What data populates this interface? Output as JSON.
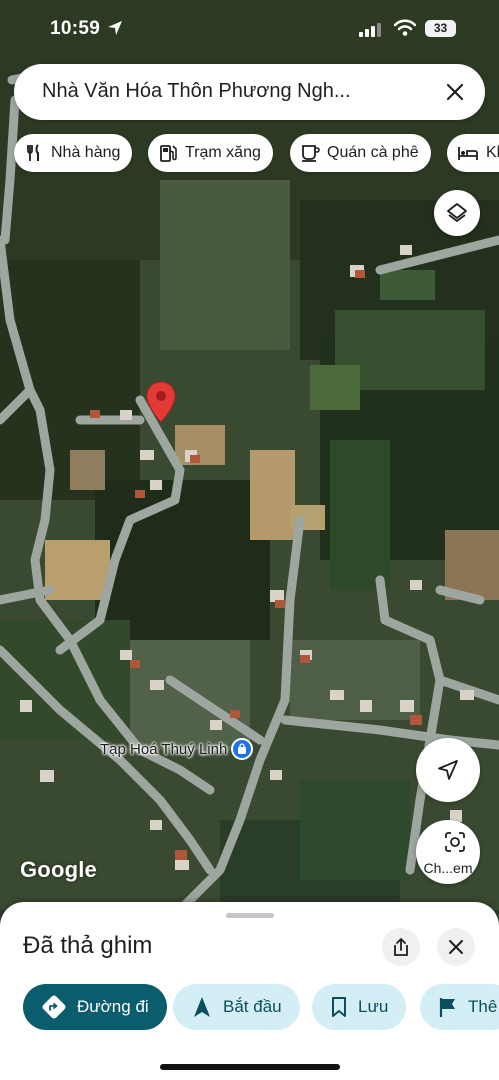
{
  "status_bar": {
    "time": "10:59",
    "battery": "33"
  },
  "search": {
    "query": "Nhà Văn Hóa Thôn Phương Ngh..."
  },
  "chips": [
    {
      "label": "Nhà hàng",
      "icon": "fork-knife-icon"
    },
    {
      "label": "Trạm xăng",
      "icon": "gas-station-icon"
    },
    {
      "label": "Quán cà phê",
      "icon": "coffee-cup-icon"
    },
    {
      "label": "Kh",
      "icon": "bed-icon"
    }
  ],
  "map": {
    "poi_label": "Tạp Hoá Thuý Linh",
    "attribution": "Google",
    "lens_label": "Ch...em",
    "colors": {
      "pin": "#e53935",
      "poi": "#1a73e8",
      "road": "#9ea6a0"
    }
  },
  "sheet": {
    "title": "Đã thả ghim",
    "actions": [
      {
        "label": "Đường đi",
        "icon": "directions-icon"
      },
      {
        "label": "Bắt đầu",
        "icon": "navigation-icon"
      },
      {
        "label": "Lưu",
        "icon": "bookmark-icon"
      },
      {
        "label": "Thê",
        "icon": "flag-icon"
      }
    ],
    "colors": {
      "primary": "#0b5d6e",
      "secondary": "#d3eef4"
    }
  }
}
